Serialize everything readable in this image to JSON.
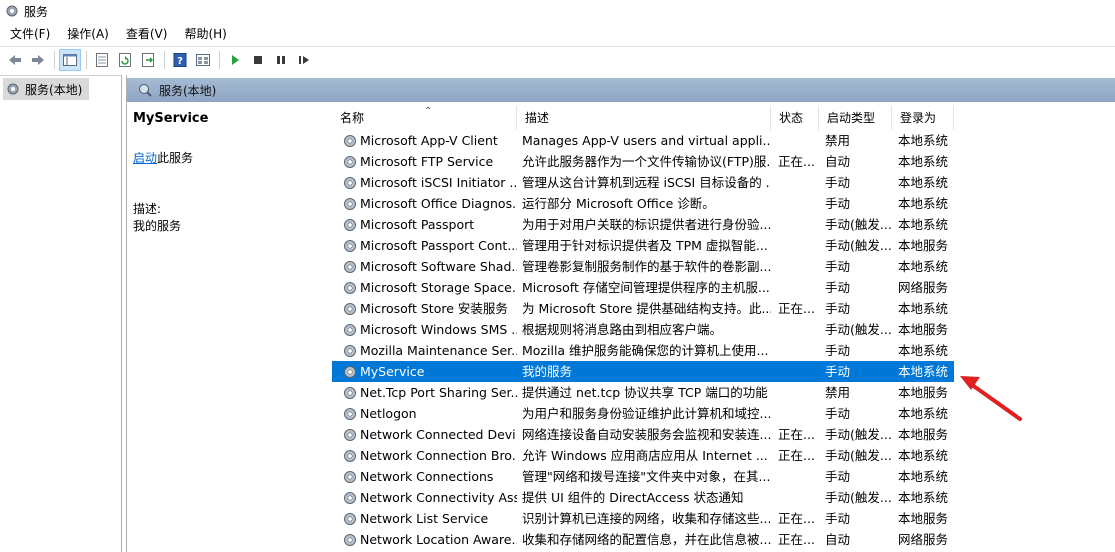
{
  "window": {
    "title": "服务"
  },
  "menu": [
    "文件(F)",
    "操作(A)",
    "查看(V)",
    "帮助(H)"
  ],
  "toolbar": {
    "icons": [
      "back-icon",
      "forward-icon",
      "console-tree-icon",
      "properties-icon",
      "refresh-icon",
      "export-icon",
      "help-icon",
      "view-icon",
      "play-icon",
      "stop-icon",
      "pause-icon",
      "resume-icon"
    ]
  },
  "tree": {
    "root_label": "服务(本地)"
  },
  "pane": {
    "header": "服务(本地)"
  },
  "extended": {
    "service_name": "MyService",
    "start_link": "启动",
    "start_suffix": "此服务",
    "desc_label": "描述:",
    "desc_text": "我的服务"
  },
  "columns": {
    "name": "名称",
    "desc": "描述",
    "status": "状态",
    "start": "启动类型",
    "logon": "登录为"
  },
  "services": [
    {
      "name": "Microsoft App-V Client",
      "desc": "Manages App-V users and virtual appli...",
      "status": "",
      "start": "禁用",
      "logon": "本地系统"
    },
    {
      "name": "Microsoft FTP Service",
      "desc": "允许此服务器作为一个文件传输协议(FTP)服...",
      "status": "正在...",
      "start": "自动",
      "logon": "本地系统"
    },
    {
      "name": "Microsoft iSCSI Initiator ...",
      "desc": "管理从这台计算机到远程 iSCSI 目标设备的 ...",
      "status": "",
      "start": "手动",
      "logon": "本地系统"
    },
    {
      "name": "Microsoft Office Diagnos...",
      "desc": "运行部分 Microsoft Office 诊断。",
      "status": "",
      "start": "手动",
      "logon": "本地系统"
    },
    {
      "name": "Microsoft Passport",
      "desc": "为用于对用户关联的标识提供者进行身份验...",
      "status": "",
      "start": "手动(触发...",
      "logon": "本地系统"
    },
    {
      "name": "Microsoft Passport Cont...",
      "desc": "管理用于针对标识提供者及 TPM 虚拟智能...",
      "status": "",
      "start": "手动(触发...",
      "logon": "本地服务"
    },
    {
      "name": "Microsoft Software Shad...",
      "desc": "管理卷影复制服务制作的基于软件的卷影副...",
      "status": "",
      "start": "手动",
      "logon": "本地系统"
    },
    {
      "name": "Microsoft Storage Space...",
      "desc": "Microsoft 存储空间管理提供程序的主机服...",
      "status": "",
      "start": "手动",
      "logon": "网络服务"
    },
    {
      "name": "Microsoft Store 安装服务",
      "desc": "为 Microsoft Store 提供基础结构支持。此...",
      "status": "正在...",
      "start": "手动",
      "logon": "本地系统"
    },
    {
      "name": "Microsoft Windows SMS ...",
      "desc": "根据规则将消息路由到相应客户端。",
      "status": "",
      "start": "手动(触发...",
      "logon": "本地服务"
    },
    {
      "name": "Mozilla Maintenance Ser...",
      "desc": "Mozilla 维护服务能确保您的计算机上使用...",
      "status": "",
      "start": "手动",
      "logon": "本地系统"
    },
    {
      "name": "MyService",
      "desc": "我的服务",
      "status": "",
      "start": "手动",
      "logon": "本地系统",
      "selected": true
    },
    {
      "name": "Net.Tcp Port Sharing Ser...",
      "desc": "提供通过 net.tcp 协议共享 TCP 端口的功能",
      "status": "",
      "start": "禁用",
      "logon": "本地服务"
    },
    {
      "name": "Netlogon",
      "desc": "为用户和服务身份验证维护此计算机和域控...",
      "status": "",
      "start": "手动",
      "logon": "本地系统"
    },
    {
      "name": "Network Connected Devi...",
      "desc": "网络连接设备自动安装服务会监视和安装连...",
      "status": "正在...",
      "start": "手动(触发...",
      "logon": "本地服务"
    },
    {
      "name": "Network Connection Bro...",
      "desc": "允许 Windows 应用商店应用从 Internet ...",
      "status": "正在...",
      "start": "手动(触发...",
      "logon": "本地系统"
    },
    {
      "name": "Network Connections",
      "desc": "管理\"网络和拨号连接\"文件夹中对象，在其...",
      "status": "",
      "start": "手动",
      "logon": "本地系统"
    },
    {
      "name": "Network Connectivity Ass...",
      "desc": "提供 UI 组件的 DirectAccess 状态通知",
      "status": "",
      "start": "手动(触发...",
      "logon": "本地系统"
    },
    {
      "name": "Network List Service",
      "desc": "识别计算机已连接的网络，收集和存储这些...",
      "status": "正在...",
      "start": "手动",
      "logon": "本地服务"
    },
    {
      "name": "Network Location Aware...",
      "desc": "收集和存储网络的配置信息，并在此信息被...",
      "status": "正在...",
      "start": "自动",
      "logon": "网络服务"
    }
  ],
  "colors": {
    "selection": "#0078d7",
    "header_bar": "#8ea6c3",
    "annotation_arrow": "#e02020"
  }
}
